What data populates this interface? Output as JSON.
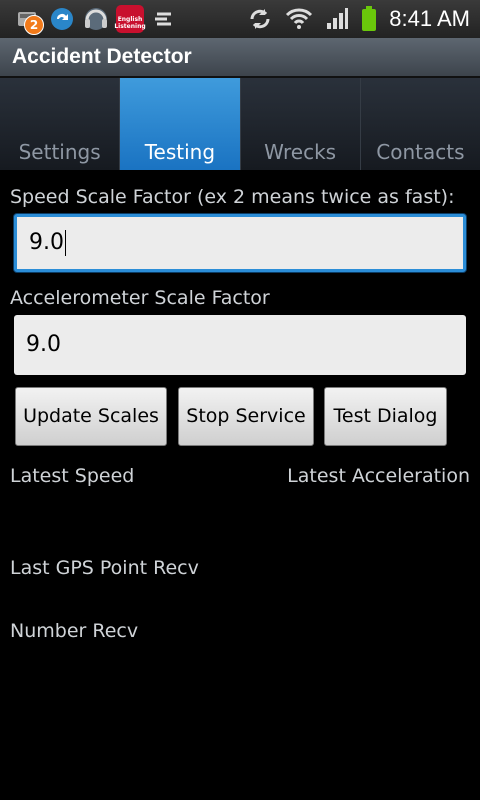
{
  "status_bar": {
    "notification_count": "2",
    "app_icon_label": "English Listening",
    "time": "8:41 AM"
  },
  "title_bar": {
    "title": "Accident Detector"
  },
  "tabs": [
    {
      "label": "Settings",
      "selected": false
    },
    {
      "label": "Testing",
      "selected": true
    },
    {
      "label": "Wrecks",
      "selected": false
    },
    {
      "label": "Contacts",
      "selected": false
    }
  ],
  "form": {
    "speed_label": "Speed Scale Factor (ex 2 means twice as fast):",
    "speed_value": "9.0",
    "accel_label": "Accelerometer Scale Factor",
    "accel_value": "9.0"
  },
  "buttons": {
    "update": "Update Scales",
    "stop": "Stop Service",
    "test": "Test Dialog"
  },
  "readouts": {
    "latest_speed": "Latest Speed",
    "latest_acceleration": "Latest Acceleration",
    "last_gps": "Last GPS Point Recv",
    "number_recv": "Number Recv"
  },
  "colors": {
    "tab_selected": "#2b8dd7",
    "title_bar": "#4a525b"
  }
}
